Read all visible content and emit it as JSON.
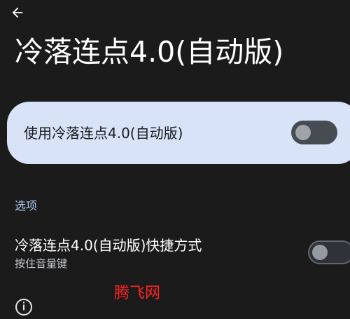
{
  "header": {
    "back_icon": "arrow-back-icon",
    "title": "冷落连点4.0(自动版)"
  },
  "main_toggle": {
    "label": "使用冷落连点4.0(自动版)",
    "state": "off"
  },
  "options": {
    "section_label": "选项",
    "shortcut": {
      "title": "冷落连点4.0(自动版)快捷方式",
      "subtitle": "按住音量键",
      "state": "off"
    }
  },
  "watermark": "腾飞网",
  "footer_icon": "info-icon",
  "colors": {
    "background": "#1b1b1b",
    "card": "#d8e3f8",
    "section_header": "#aec8ef",
    "switch_track_main": "#474b52",
    "watermark": "#ff2525"
  }
}
